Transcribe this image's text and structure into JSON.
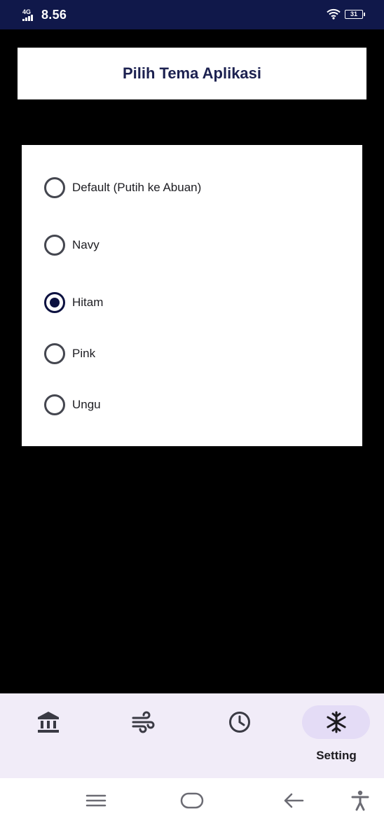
{
  "status_bar": {
    "network_label": "4G",
    "time": "8.56",
    "battery": "31"
  },
  "header": {
    "title": "Pilih Tema Aplikasi"
  },
  "theme_options": [
    {
      "label": "Default (Putih ke Abuan)",
      "selected": false
    },
    {
      "label": "Navy",
      "selected": false
    },
    {
      "label": "Hitam",
      "selected": true
    },
    {
      "label": "Pink",
      "selected": false
    },
    {
      "label": "Ungu",
      "selected": false
    }
  ],
  "bottom_nav": {
    "items": [
      {
        "icon": "bank-icon",
        "label": ""
      },
      {
        "icon": "wind-icon",
        "label": ""
      },
      {
        "icon": "clock-icon",
        "label": ""
      },
      {
        "icon": "snowflake-icon",
        "label": "Setting",
        "active": true
      }
    ]
  },
  "system_nav": {
    "buttons": [
      "menu-icon",
      "home-icon",
      "back-icon",
      "accessibility-icon"
    ]
  },
  "colors": {
    "status_bar": "#10184a",
    "background": "#000000",
    "accent": "#0c1140",
    "title_text": "#1c2150",
    "nav_background": "#f1ecf8",
    "nav_active_pill": "#e4dcf6"
  }
}
